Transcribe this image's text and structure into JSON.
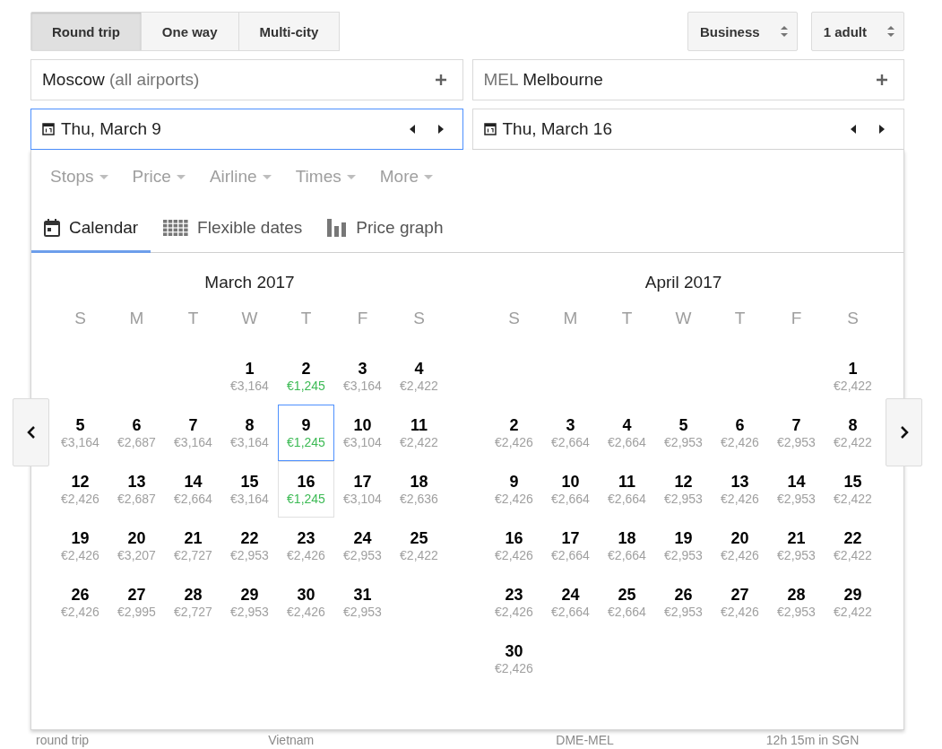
{
  "trip_types": [
    {
      "label": "Round trip",
      "selected": true
    },
    {
      "label": "One way",
      "selected": false
    },
    {
      "label": "Multi-city",
      "selected": false
    }
  ],
  "cabin": {
    "value": "Business"
  },
  "passengers": {
    "value": "1 adult"
  },
  "places": [
    {
      "parts": [
        {
          "text": "Moscow",
          "muted": false
        },
        {
          "text": "(all airports)",
          "muted": true
        }
      ]
    },
    {
      "parts": [
        {
          "text": "MEL",
          "muted": true
        },
        {
          "text": "Melbourne",
          "muted": false
        }
      ]
    }
  ],
  "dates": [
    {
      "value": "Thu, March 9",
      "focused": true
    },
    {
      "value": "Thu, March 16",
      "focused": false
    }
  ],
  "filters": [
    "Stops",
    "Price",
    "Airline",
    "Times",
    "More"
  ],
  "views": [
    {
      "label": "Calendar",
      "kind": "calendar",
      "selected": true
    },
    {
      "label": "Flexible dates",
      "kind": "grid",
      "selected": false
    },
    {
      "label": "Price graph",
      "kind": "graph",
      "selected": false
    }
  ],
  "months": [
    {
      "title": "March 2017",
      "weekdays": [
        "S",
        "M",
        "T",
        "W",
        "T",
        "F",
        "S"
      ],
      "days": [
        {
          "day": "1",
          "kind": "wed",
          "price": "€3,164",
          "lowest": false,
          "selected": false,
          "return": false
        },
        {
          "day": "2",
          "kind": "thu",
          "price": "€1,245",
          "lowest": true,
          "selected": false,
          "return": false
        },
        {
          "day": "3",
          "kind": "fri",
          "price": "€3,164",
          "lowest": false,
          "selected": false,
          "return": false
        },
        {
          "day": "4",
          "kind": "sat",
          "price": "€2,422",
          "lowest": false,
          "selected": false,
          "return": false
        },
        {
          "day": "5",
          "kind": "sun",
          "price": "€3,164",
          "lowest": false,
          "selected": false,
          "return": false
        },
        {
          "day": "6",
          "kind": "mon",
          "price": "€2,687",
          "lowest": false,
          "selected": false,
          "return": false
        },
        {
          "day": "7",
          "kind": "tue",
          "price": "€3,164",
          "lowest": false,
          "selected": false,
          "return": false
        },
        {
          "day": "8",
          "kind": "wed",
          "price": "€3,164",
          "lowest": false,
          "selected": false,
          "return": false
        },
        {
          "day": "9",
          "kind": "thu",
          "price": "€1,245",
          "lowest": true,
          "selected": true,
          "return": false
        },
        {
          "day": "10",
          "kind": "fri",
          "price": "€3,104",
          "lowest": false,
          "selected": false,
          "return": false
        },
        {
          "day": "11",
          "kind": "sat",
          "price": "€2,422",
          "lowest": false,
          "selected": false,
          "return": false
        },
        {
          "day": "12",
          "kind": "sun",
          "price": "€2,426",
          "lowest": false,
          "selected": false,
          "return": false
        },
        {
          "day": "13",
          "kind": "mon",
          "price": "€2,687",
          "lowest": false,
          "selected": false,
          "return": false
        },
        {
          "day": "14",
          "kind": "tue",
          "price": "€2,664",
          "lowest": false,
          "selected": false,
          "return": false
        },
        {
          "day": "15",
          "kind": "wed",
          "price": "€3,164",
          "lowest": false,
          "selected": false,
          "return": false
        },
        {
          "day": "16",
          "kind": "thu",
          "price": "€1,245",
          "lowest": true,
          "selected": false,
          "return": true
        },
        {
          "day": "17",
          "kind": "fri",
          "price": "€3,104",
          "lowest": false,
          "selected": false,
          "return": false
        },
        {
          "day": "18",
          "kind": "sat",
          "price": "€2,636",
          "lowest": false,
          "selected": false,
          "return": false
        },
        {
          "day": "19",
          "kind": "sun",
          "price": "€2,426",
          "lowest": false,
          "selected": false,
          "return": false
        },
        {
          "day": "20",
          "kind": "mon",
          "price": "€3,207",
          "lowest": false,
          "selected": false,
          "return": false
        },
        {
          "day": "21",
          "kind": "tue",
          "price": "€2,727",
          "lowest": false,
          "selected": false,
          "return": false
        },
        {
          "day": "22",
          "kind": "wed",
          "price": "€2,953",
          "lowest": false,
          "selected": false,
          "return": false
        },
        {
          "day": "23",
          "kind": "thu",
          "price": "€2,426",
          "lowest": false,
          "selected": false,
          "return": false
        },
        {
          "day": "24",
          "kind": "fri",
          "price": "€2,953",
          "lowest": false,
          "selected": false,
          "return": false
        },
        {
          "day": "25",
          "kind": "sat",
          "price": "€2,422",
          "lowest": false,
          "selected": false,
          "return": false
        },
        {
          "day": "26",
          "kind": "sun",
          "price": "€2,426",
          "lowest": false,
          "selected": false,
          "return": false
        },
        {
          "day": "27",
          "kind": "mon",
          "price": "€2,995",
          "lowest": false,
          "selected": false,
          "return": false
        },
        {
          "day": "28",
          "kind": "tue",
          "price": "€2,727",
          "lowest": false,
          "selected": false,
          "return": false
        },
        {
          "day": "29",
          "kind": "wed",
          "price": "€2,953",
          "lowest": false,
          "selected": false,
          "return": false
        },
        {
          "day": "30",
          "kind": "thu",
          "price": "€2,426",
          "lowest": false,
          "selected": false,
          "return": false
        },
        {
          "day": "31",
          "kind": "fri",
          "price": "€2,953",
          "lowest": false,
          "selected": false,
          "return": false
        }
      ]
    },
    {
      "title": "April 2017",
      "weekdays": [
        "S",
        "M",
        "T",
        "W",
        "T",
        "F",
        "S"
      ],
      "days": [
        {
          "day": "1",
          "kind": "sat",
          "price": "€2,422",
          "lowest": false,
          "selected": false,
          "return": false
        },
        {
          "day": "2",
          "kind": "sun",
          "price": "€2,426",
          "lowest": false,
          "selected": false,
          "return": false
        },
        {
          "day": "3",
          "kind": "mon",
          "price": "€2,664",
          "lowest": false,
          "selected": false,
          "return": false
        },
        {
          "day": "4",
          "kind": "tue",
          "price": "€2,664",
          "lowest": false,
          "selected": false,
          "return": false
        },
        {
          "day": "5",
          "kind": "wed",
          "price": "€2,953",
          "lowest": false,
          "selected": false,
          "return": false
        },
        {
          "day": "6",
          "kind": "thu",
          "price": "€2,426",
          "lowest": false,
          "selected": false,
          "return": false
        },
        {
          "day": "7",
          "kind": "fri",
          "price": "€2,953",
          "lowest": false,
          "selected": false,
          "return": false
        },
        {
          "day": "8",
          "kind": "sat",
          "price": "€2,422",
          "lowest": false,
          "selected": false,
          "return": false
        },
        {
          "day": "9",
          "kind": "sun",
          "price": "€2,426",
          "lowest": false,
          "selected": false,
          "return": false
        },
        {
          "day": "10",
          "kind": "mon",
          "price": "€2,664",
          "lowest": false,
          "selected": false,
          "return": false
        },
        {
          "day": "11",
          "kind": "tue",
          "price": "€2,664",
          "lowest": false,
          "selected": false,
          "return": false
        },
        {
          "day": "12",
          "kind": "wed",
          "price": "€2,953",
          "lowest": false,
          "selected": false,
          "return": false
        },
        {
          "day": "13",
          "kind": "thu",
          "price": "€2,426",
          "lowest": false,
          "selected": false,
          "return": false
        },
        {
          "day": "14",
          "kind": "fri",
          "price": "€2,953",
          "lowest": false,
          "selected": false,
          "return": false
        },
        {
          "day": "15",
          "kind": "sat",
          "price": "€2,422",
          "lowest": false,
          "selected": false,
          "return": false
        },
        {
          "day": "16",
          "kind": "sun",
          "price": "€2,426",
          "lowest": false,
          "selected": false,
          "return": false
        },
        {
          "day": "17",
          "kind": "mon",
          "price": "€2,664",
          "lowest": false,
          "selected": false,
          "return": false
        },
        {
          "day": "18",
          "kind": "tue",
          "price": "€2,664",
          "lowest": false,
          "selected": false,
          "return": false
        },
        {
          "day": "19",
          "kind": "wed",
          "price": "€2,953",
          "lowest": false,
          "selected": false,
          "return": false
        },
        {
          "day": "20",
          "kind": "thu",
          "price": "€2,426",
          "lowest": false,
          "selected": false,
          "return": false
        },
        {
          "day": "21",
          "kind": "fri",
          "price": "€2,953",
          "lowest": false,
          "selected": false,
          "return": false
        },
        {
          "day": "22",
          "kind": "sat",
          "price": "€2,422",
          "lowest": false,
          "selected": false,
          "return": false
        },
        {
          "day": "23",
          "kind": "sun",
          "price": "€2,426",
          "lowest": false,
          "selected": false,
          "return": false
        },
        {
          "day": "24",
          "kind": "mon",
          "price": "€2,664",
          "lowest": false,
          "selected": false,
          "return": false
        },
        {
          "day": "25",
          "kind": "tue",
          "price": "€2,664",
          "lowest": false,
          "selected": false,
          "return": false
        },
        {
          "day": "26",
          "kind": "wed",
          "price": "€2,953",
          "lowest": false,
          "selected": false,
          "return": false
        },
        {
          "day": "27",
          "kind": "thu",
          "price": "€2,426",
          "lowest": false,
          "selected": false,
          "return": false
        },
        {
          "day": "28",
          "kind": "fri",
          "price": "€2,953",
          "lowest": false,
          "selected": false,
          "return": false
        },
        {
          "day": "29",
          "kind": "sat",
          "price": "€2,422",
          "lowest": false,
          "selected": false,
          "return": false
        },
        {
          "day": "30",
          "kind": "sun",
          "price": "€2,426",
          "lowest": false,
          "selected": false,
          "return": false
        }
      ]
    }
  ],
  "result_row": {
    "fare_note": "round trip",
    "airline": "Vietnam",
    "route": "DME-MEL",
    "layover": "12h 15m in SGN"
  }
}
